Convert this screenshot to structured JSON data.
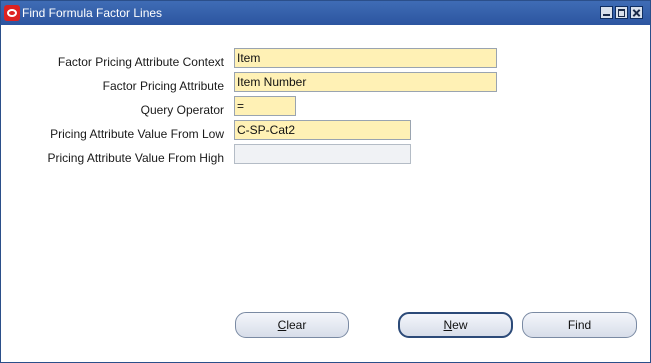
{
  "window": {
    "title": "Find Formula Factor Lines"
  },
  "form": {
    "fields": [
      {
        "label": "Factor Pricing Attribute Context",
        "value": "Item"
      },
      {
        "label": "Factor Pricing Attribute",
        "value": "Item Number"
      },
      {
        "label": "Query Operator",
        "value": "="
      },
      {
        "label": "Pricing Attribute Value From Low",
        "value": "C-SP-Cat2"
      },
      {
        "label": "Pricing Attribute Value From High",
        "value": ""
      }
    ]
  },
  "buttons": {
    "clear": {
      "mnemonic": "C",
      "rest": "lear"
    },
    "new": {
      "mnemonic": "N",
      "rest": "ew"
    },
    "find": {
      "label": "Find"
    }
  },
  "colors": {
    "titlebar": "#2c55a0",
    "required_field": "#fff1b5",
    "empty_field": "#f0f2f5"
  },
  "icons": [
    "oracle-app-icon",
    "minimize-icon",
    "maximize-icon",
    "close-icon"
  ]
}
